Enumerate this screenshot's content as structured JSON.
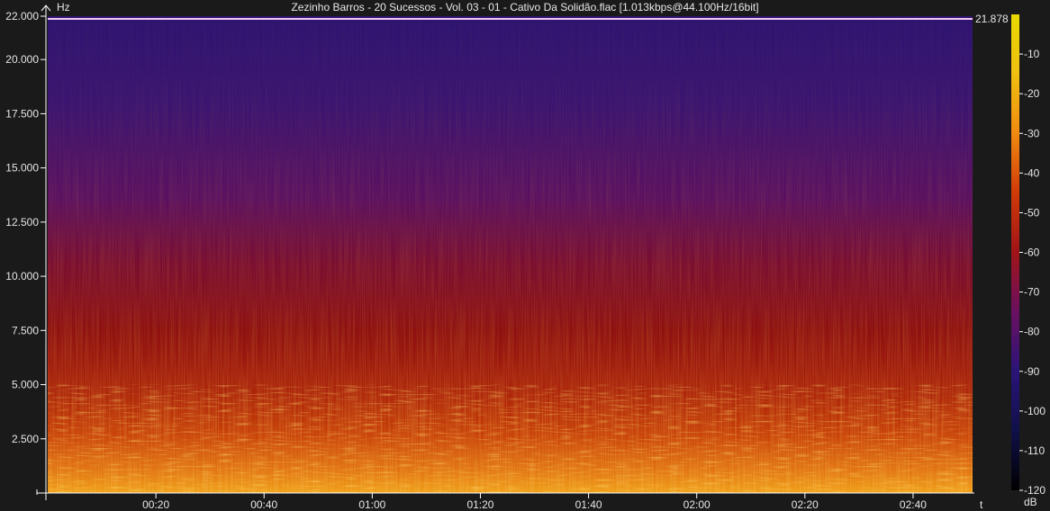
{
  "title": "Zezinho Barros - 20 Sucessos - Vol. 03 - 01 - Cativo Da Solidão.flac [1.013kbps@44.100Hz/16bit]",
  "chart_data": {
    "type": "heatmap",
    "title": "Zezinho Barros - 20 Sucessos - Vol. 03 - 01 - Cativo Da Solidão.flac [1.013kbps@44.100Hz/16bit]",
    "xlabel": "t",
    "ylabel": "Hz",
    "xlim": [
      0,
      171
    ],
    "ylim": [
      0,
      22000
    ],
    "x_ticks": [
      {
        "value": 20,
        "label": "00:20"
      },
      {
        "value": 40,
        "label": "00:40"
      },
      {
        "value": 60,
        "label": "01:00"
      },
      {
        "value": 80,
        "label": "01:20"
      },
      {
        "value": 100,
        "label": "01:40"
      },
      {
        "value": 120,
        "label": "02:00"
      },
      {
        "value": 140,
        "label": "02:20"
      },
      {
        "value": 160,
        "label": "02:40"
      }
    ],
    "y_ticks": [
      {
        "value": 2500,
        "label": "2.500"
      },
      {
        "value": 5000,
        "label": "5.000"
      },
      {
        "value": 7500,
        "label": "7.500"
      },
      {
        "value": 10000,
        "label": "10.000"
      },
      {
        "value": 12500,
        "label": "12.500"
      },
      {
        "value": 15000,
        "label": "15.000"
      },
      {
        "value": 17500,
        "label": "17.500"
      },
      {
        "value": 20000,
        "label": "20.000"
      },
      {
        "value": 22000,
        "label": "22.000"
      }
    ],
    "cutoff_line": {
      "value": 21878,
      "label": "21.878"
    },
    "colorbar": {
      "unit": "dB",
      "range": [
        -120,
        0
      ],
      "ticks": [
        {
          "value": -10,
          "label": "-10"
        },
        {
          "value": -20,
          "label": "-20"
        },
        {
          "value": -30,
          "label": "-30"
        },
        {
          "value": -40,
          "label": "-40"
        },
        {
          "value": -50,
          "label": "-50"
        },
        {
          "value": -60,
          "label": "-60"
        },
        {
          "value": -70,
          "label": "-70"
        },
        {
          "value": -80,
          "label": "-80"
        },
        {
          "value": -90,
          "label": "-90"
        },
        {
          "value": -100,
          "label": "-100"
        },
        {
          "value": -110,
          "label": "-110"
        },
        {
          "value": -120,
          "label": "-120"
        }
      ],
      "colors": [
        "#000000",
        "#10104a",
        "#2a1478",
        "#6a1060",
        "#a01418",
        "#d03a08",
        "#f08a10",
        "#f0c010",
        "#e8d800"
      ]
    },
    "grid": false,
    "colors": {
      "background": "#1a1a1a",
      "axis": "#ffffff",
      "cutoff": "#f3c9f7"
    }
  }
}
